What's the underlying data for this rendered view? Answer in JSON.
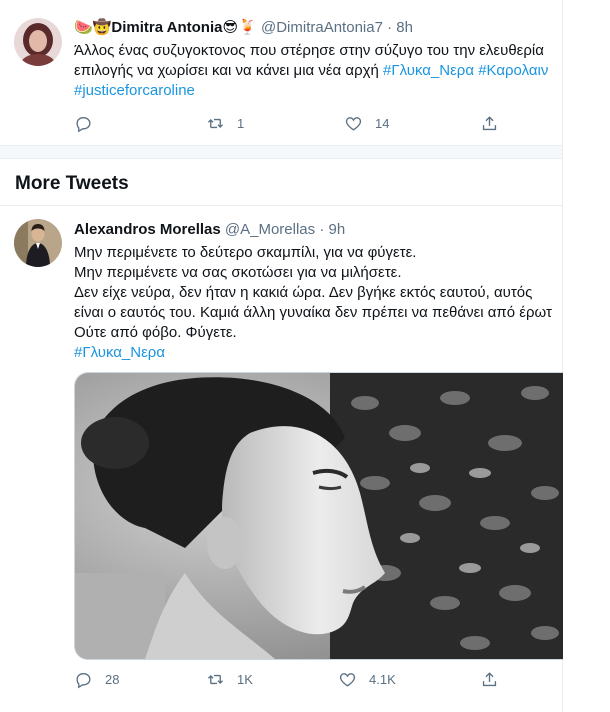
{
  "tweet1": {
    "display_name": "Dimitra Antonia",
    "name_emoji_left": "🍉🤠",
    "name_emoji_right": "😎🍹",
    "handle": "@DimitraAntonia7",
    "separator": "·",
    "time": "8h",
    "line1": "Άλλος ένας συζυγοκτονος που στέρησε στην σύζυγο του την ελευθερία",
    "line2_text": "επιλογής να χωρίσει και να κάνει μια νέα αρχή ",
    "line2_tag1": "#Γλυκα_Νερα",
    "line2_tag2": "#Καρολαιν",
    "line3_tag": "#justiceforcaroline",
    "reply_count": "",
    "retweet_count": "1",
    "like_count": "14"
  },
  "section": {
    "title": "More Tweets"
  },
  "tweet2": {
    "display_name": "Alexandros Morellas",
    "handle": "@A_Morellas",
    "separator": "·",
    "time": "9h",
    "lines": [
      "Μην περιμένετε το δεύτερο σκαμπίλι, για να φύγετε.",
      "Μην περιμένετε να σας σκοτώσει για να μιλήσετε.",
      "Δεν είχε νεύρα, δεν ήταν η κακιά ώρα. Δεν βγήκε εκτός εαυτού, αυτός",
      "είναι ο εαυτός του. Καμιά άλλη γυναίκα δεν πρέπει να πεθάνει από έρωτ",
      "Ούτε από φόβο. Φύγετε."
    ],
    "hashtag": "#Γλυκα_Νερα",
    "reply_count": "28",
    "retweet_count": "1K",
    "like_count": "4.1K"
  },
  "icons": {
    "reply": "reply-icon",
    "retweet": "retweet-icon",
    "like": "heart-icon",
    "share": "share-icon"
  },
  "colors": {
    "link": "#1b95e0",
    "secondary_text": "#5b7083",
    "divider": "#ebeef0"
  }
}
